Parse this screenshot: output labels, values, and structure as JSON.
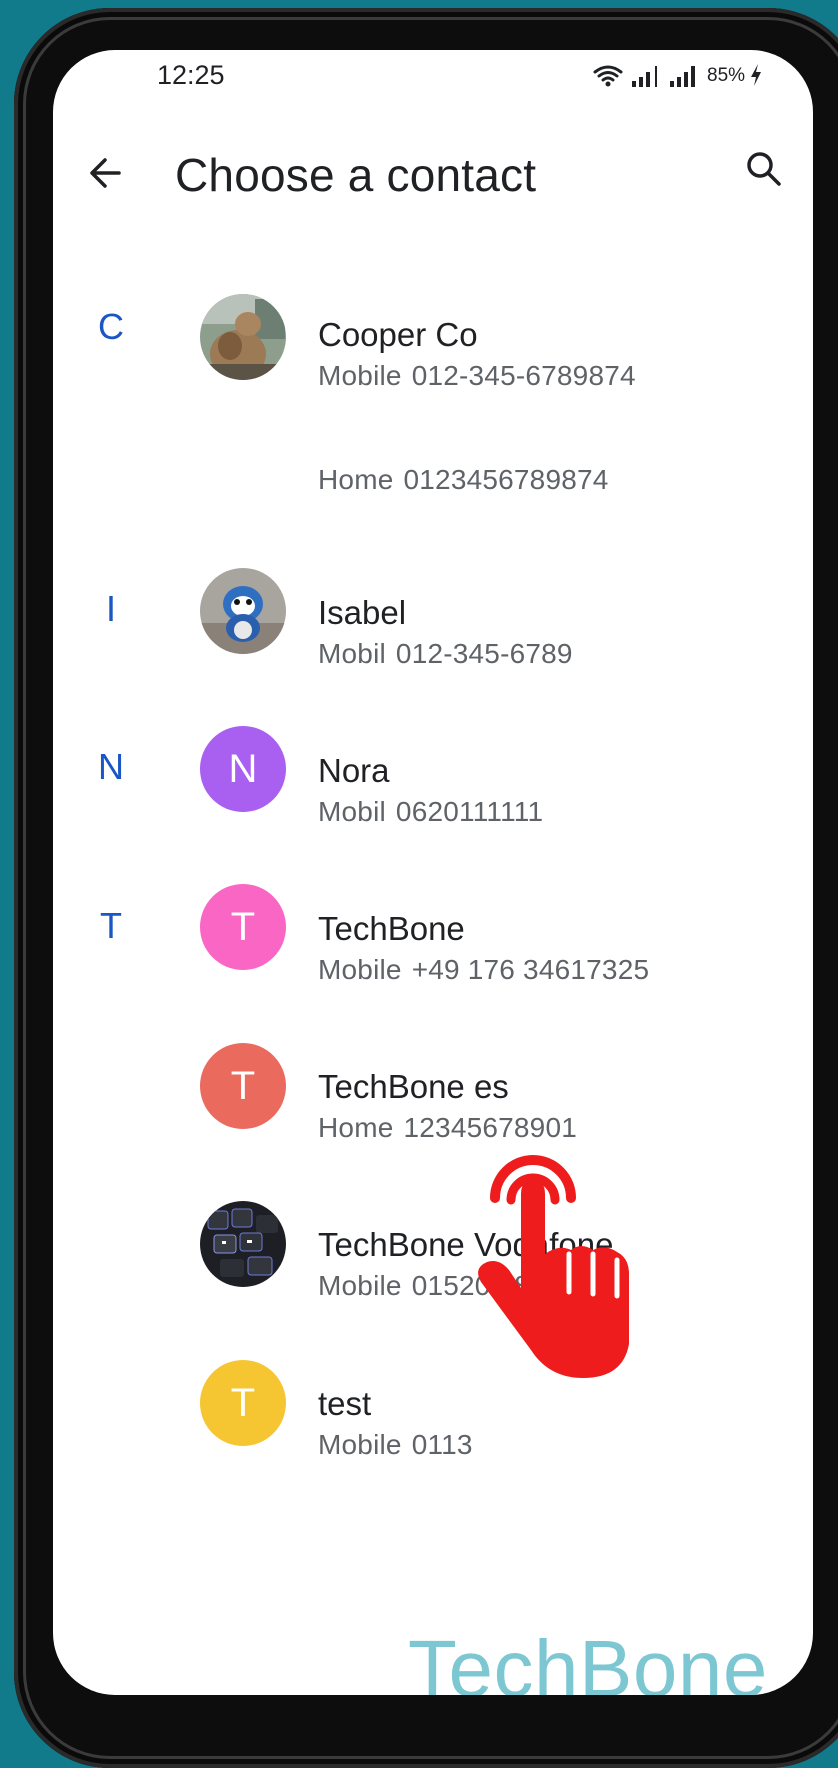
{
  "status_bar": {
    "time": "12:25",
    "battery": "85%"
  },
  "header": {
    "title": "Choose a contact"
  },
  "sections": {
    "c": {
      "letter": "C"
    },
    "i": {
      "letter": "I"
    },
    "n": {
      "letter": "N"
    },
    "t": {
      "letter": "T"
    }
  },
  "contacts": [
    {
      "name": "Cooper Co",
      "phones": [
        {
          "type": "Mobile",
          "number": "012-345-6789874"
        },
        {
          "type": "Home",
          "number": "0123456789874"
        }
      ]
    },
    {
      "name": "Isabel",
      "phones": [
        {
          "type": "Mobil",
          "number": "012-345-6789"
        }
      ]
    },
    {
      "name": "Nora",
      "initial": "N",
      "avatar_color": "#a95ff0",
      "phones": [
        {
          "type": "Mobil",
          "number": "0620111111"
        }
      ]
    },
    {
      "name": "TechBone",
      "initial": "T",
      "avatar_color": "#f966c3",
      "phones": [
        {
          "type": "Mobile",
          "number": "+49 176 34617325"
        }
      ]
    },
    {
      "name": "TechBone es",
      "initial": "T",
      "avatar_color": "#ea6a5e",
      "phones": [
        {
          "type": "Home",
          "number": "12345678901"
        }
      ]
    },
    {
      "name": "TechBone Vodafone",
      "phones": [
        {
          "type": "Mobile",
          "number": "01520 685615"
        }
      ]
    },
    {
      "name": "test",
      "initial": "T",
      "avatar_color": "#f6c632",
      "phones": [
        {
          "type": "Mobile",
          "number": "0113"
        }
      ]
    }
  ],
  "watermark": "TechBone",
  "colors": {
    "accent": "#1a56c4",
    "frame_bg": "#117a8b",
    "tap_hand": "#ee1c1c"
  },
  "icons": {
    "back": "arrow-back-icon",
    "search": "search-icon",
    "wifi": "wifi-icon",
    "signal": "signal-icon",
    "battery": "charging-icon",
    "tap": "tap-hand-icon"
  }
}
